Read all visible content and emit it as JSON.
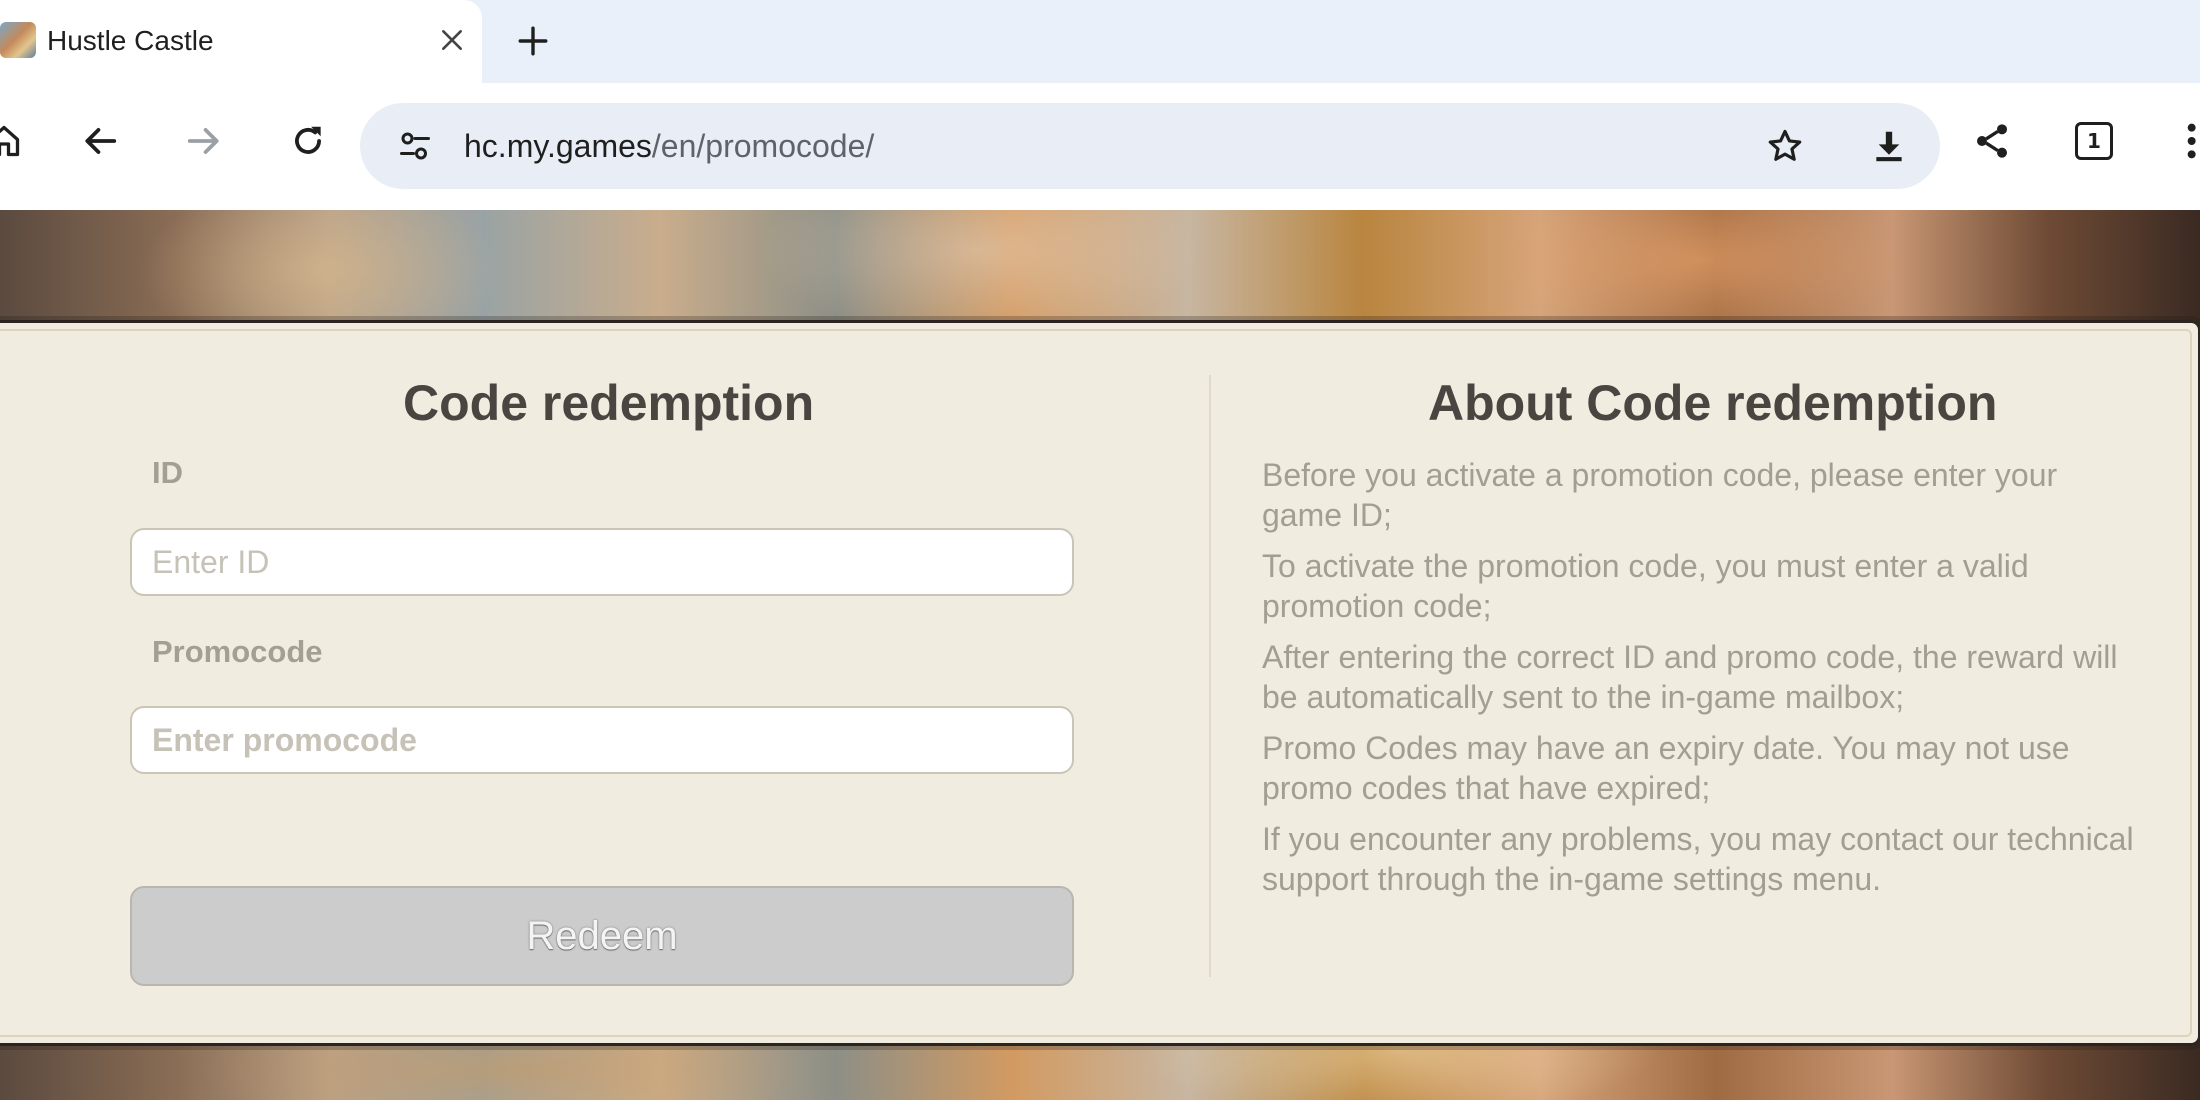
{
  "browser": {
    "tab": {
      "title": "Hustle Castle",
      "favicon": "hustle-castle-favicon"
    },
    "address_bar": {
      "url_host": "hc.my.games",
      "url_path": "/en/promocode/"
    },
    "tab_count": "1",
    "icons": [
      "home-icon",
      "back-icon",
      "forward-icon",
      "reload-icon",
      "site-settings-icon",
      "star-icon",
      "download-icon",
      "share-icon",
      "tab-switcher-icon",
      "more-menu-icon",
      "close-icon",
      "plus-icon"
    ]
  },
  "page": {
    "redemption": {
      "title": "Code redemption",
      "id_label": "ID",
      "id_placeholder": "Enter ID",
      "promo_label": "Promocode",
      "promo_placeholder": "Enter promocode",
      "redeem_label": "Redeem"
    },
    "about": {
      "title": "About Code redemption",
      "items": [
        "Before you activate a promotion code, please enter your game ID;",
        "To activate the promotion code, you must enter a valid promotion code;",
        "After entering the correct ID and promo code, the reward will be automatically sent to the in-game mailbox;",
        "Promo Codes may have an expiry date. You may not use promo codes that have expired;",
        "If you encounter any problems, you may contact our technical support through the in-game settings menu."
      ]
    }
  },
  "colors": {
    "panel_bg": "#f1ece0",
    "heading": "#4a4540",
    "muted_text": "#a29e94",
    "button_disabled": "#cccccc"
  }
}
